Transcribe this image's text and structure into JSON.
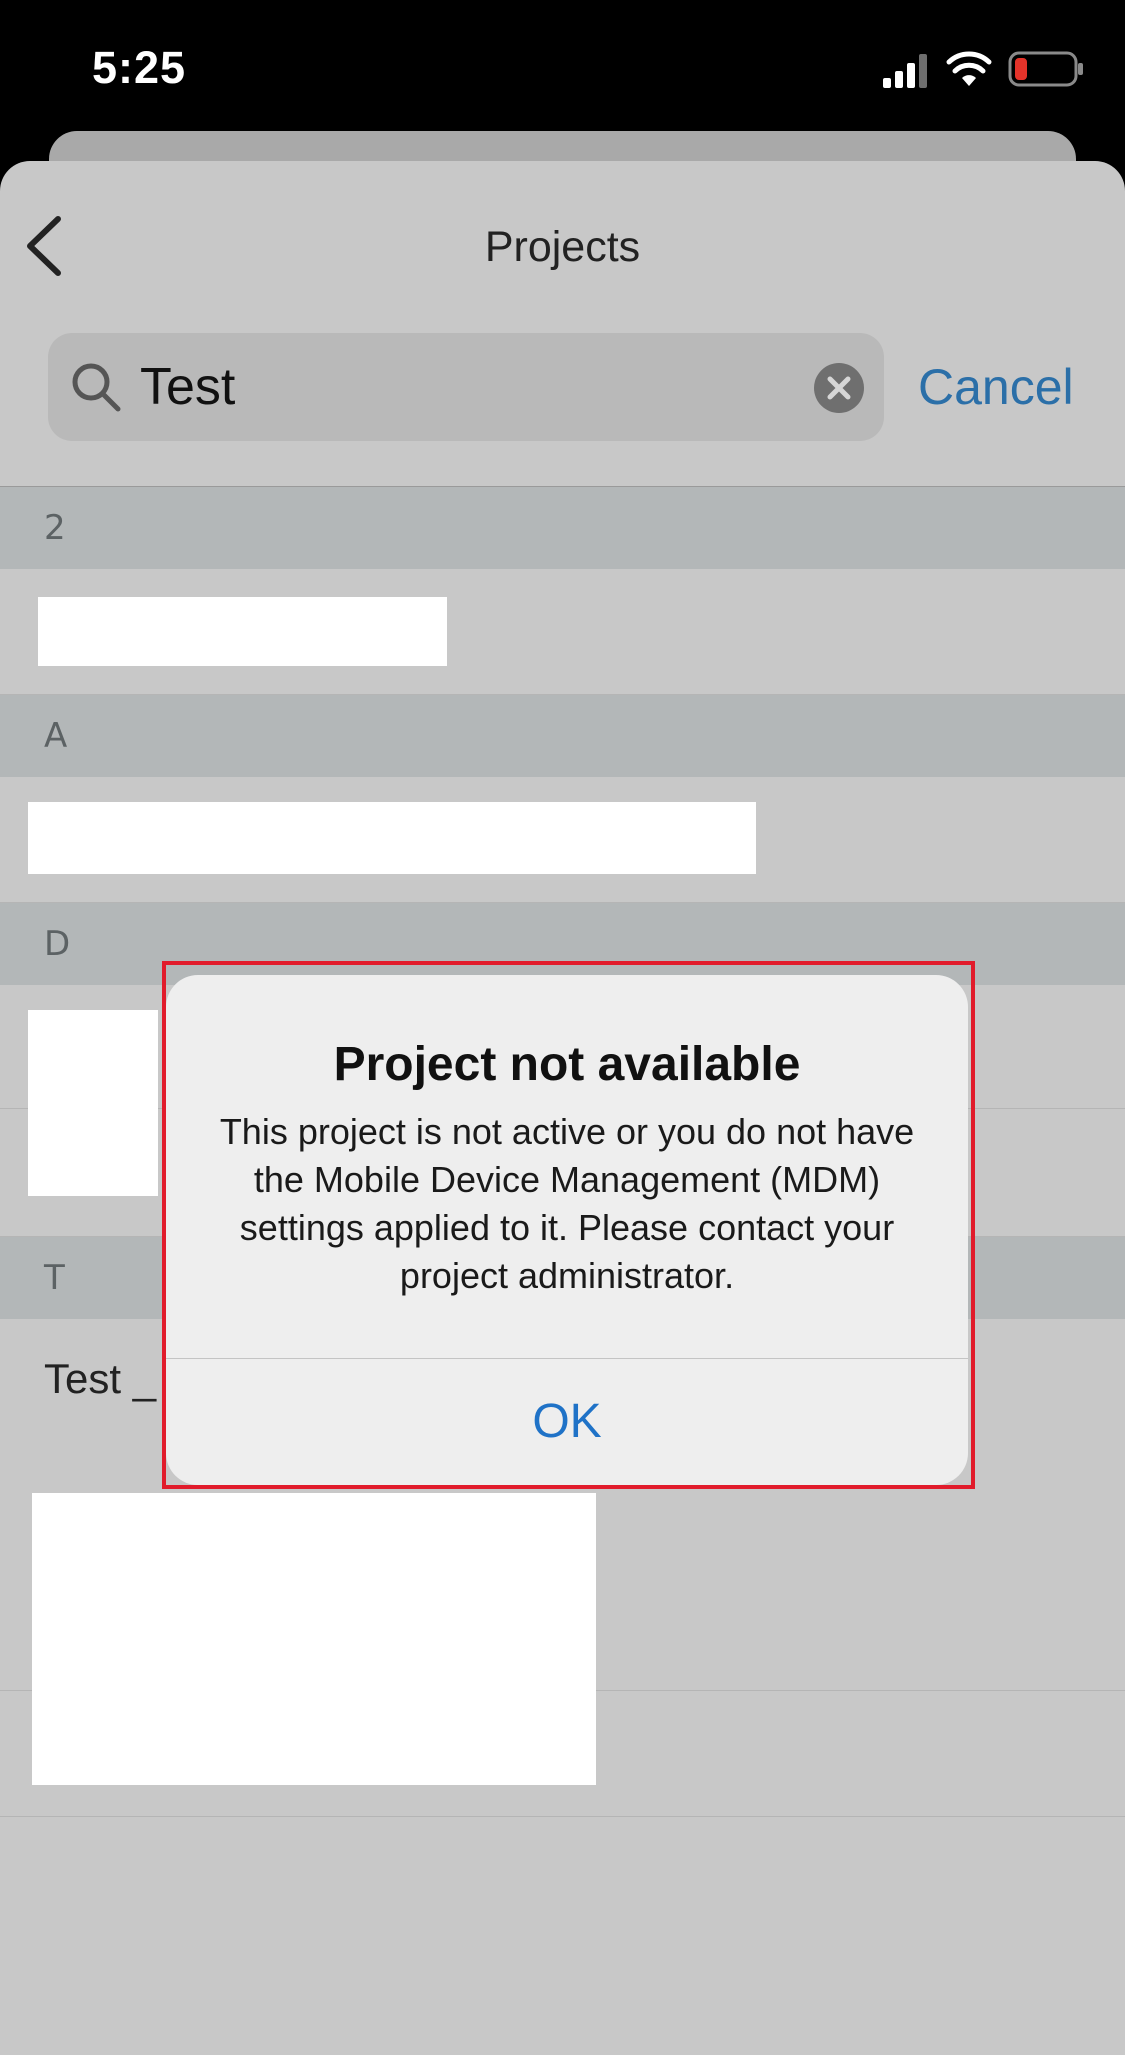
{
  "status_bar": {
    "time": "5:25",
    "signal_icon": "cellular-signal-icon",
    "wifi_icon": "wifi-icon",
    "battery_icon": "battery-low-icon",
    "battery_color": "#e5332a"
  },
  "nav": {
    "title": "Projects",
    "back_icon": "chevron-left-icon"
  },
  "search": {
    "value": "Test",
    "icon": "search-icon",
    "clear_icon": "clear-icon",
    "cancel_label": "Cancel"
  },
  "list": {
    "sections": [
      {
        "header": "2"
      },
      {
        "header": "A"
      },
      {
        "header": "D"
      },
      {
        "header": "T",
        "first_item_label": "Test _"
      }
    ]
  },
  "alert": {
    "title": "Project not available",
    "message": "This project is not active or you do not have the Mobile Device Management (MDM) settings applied to it. Please contact your project administrator.",
    "ok_label": "OK"
  },
  "colors": {
    "accent": "#1f72c7",
    "highlight": "#e11b2b"
  }
}
